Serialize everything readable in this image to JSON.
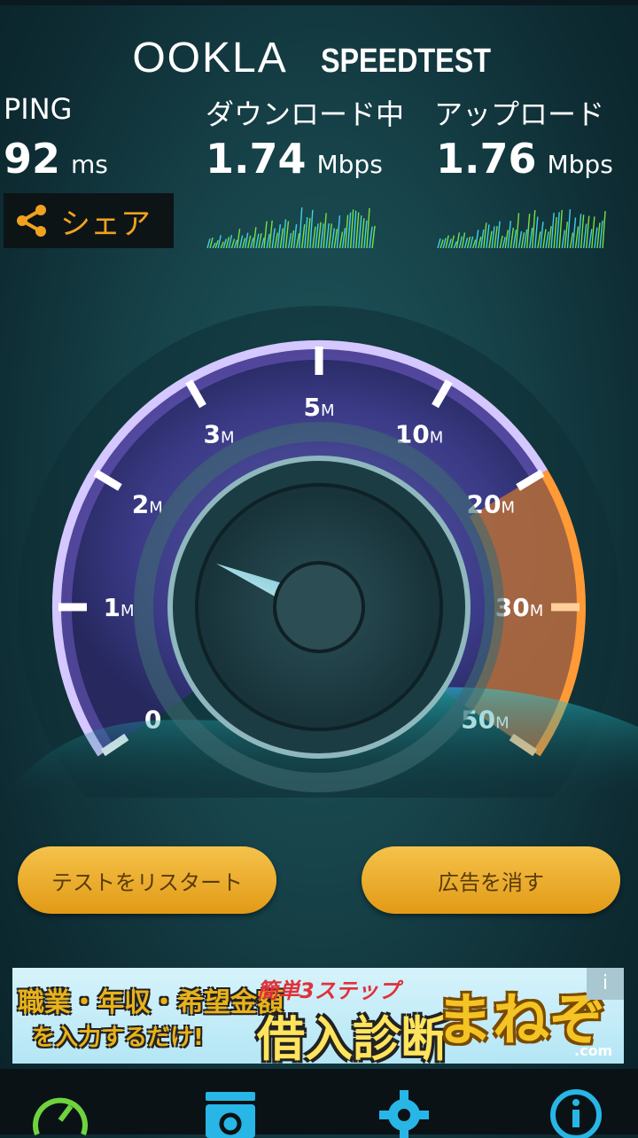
{
  "header": {
    "logo_ookla": "OOKLA",
    "logo_speedtest": "SPEEDTEST"
  },
  "stats": {
    "ping": {
      "label": "PING",
      "value": "92",
      "unit": "ms"
    },
    "download": {
      "label": "ダウンロード中",
      "value": "1.74",
      "unit": "Mbps"
    },
    "upload": {
      "label": "アップロード",
      "value": "1.76",
      "unit": "Mbps"
    }
  },
  "share": {
    "label": "シェア",
    "icon": "share-icon"
  },
  "gauge": {
    "tick_labels": [
      {
        "num": "0",
        "unit": ""
      },
      {
        "num": "1",
        "unit": "M"
      },
      {
        "num": "2",
        "unit": "M"
      },
      {
        "num": "3",
        "unit": "M"
      },
      {
        "num": "5",
        "unit": "M"
      },
      {
        "num": "10",
        "unit": "M"
      },
      {
        "num": "20",
        "unit": "M"
      },
      {
        "num": "30",
        "unit": "M"
      },
      {
        "num": "50",
        "unit": "M"
      }
    ],
    "needle_value_mbps": 1.74
  },
  "buttons": {
    "restart": "テストをリスタート",
    "remove_ads": "広告を消す"
  },
  "ad": {
    "line1": "職業・年収・希望金額",
    "line2": "を入力するだけ!",
    "steps": "簡単3ステップ",
    "main": "借入診断",
    "brand": "まねぞう",
    "domain": ".com",
    "info": "i"
  },
  "nav": {
    "items": [
      "speedometer-icon",
      "results-icon",
      "gear-icon",
      "info-icon"
    ]
  },
  "colors": {
    "accent": "#f0a21f",
    "button": "#e8a823",
    "nav_icon": "#27b6e6",
    "gauge_ring": "#8f6fe0"
  }
}
